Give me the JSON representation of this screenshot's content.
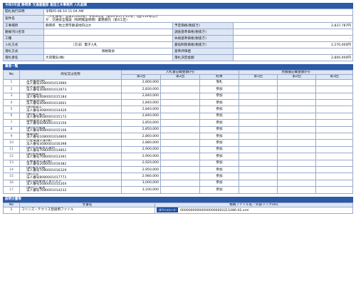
{
  "title": "令和5年度 静岡県 交通基盤部 島田土木事務所 入札結果",
  "info": {
    "rows": [
      {
        "label": "開札執行日時",
        "value": "令和05-06-10 11:04 AM"
      },
      {
        "label": "案件名",
        "value_line1": "（入札番号）島第21000号）令和3年度［第33-D571-01号］(国)150号ほか",
        "value_line2": "か　交通安全施設（照明施設修繕）業務委託（第4工区）"
      },
      {
        "label": "工事場所",
        "value": "静岡県　牧之原市静波地内ほか",
        "right_label": "予定価格(税抜き)",
        "right_value": "2,837,787円"
      },
      {
        "label": "路線河川名等",
        "value": "",
        "right_label": "調査基準価格(税抜き)",
        "right_value": ""
      },
      {
        "label": "工種",
        "value": "",
        "right_label": "失格基準価格(税抜き)",
        "right_value": "-"
      },
      {
        "label": "入札方式",
        "value": "（方法）電子入札",
        "right_label": "最低制限価格(税抜き)",
        "right_value": "2,270,000円"
      },
      {
        "label": "落札方式",
        "value": "価格競争",
        "right_label": "基準評価値",
        "right_value": "-"
      },
      {
        "label": "落札者名",
        "value": "大同電気(株)",
        "right_label": "落札決定金額",
        "right_value": "2,800,000円"
      }
    ]
  },
  "bidders_section": {
    "title": "業者一覧",
    "col_no": "No",
    "col_name": "商号又は名称",
    "group1": "入札書記載金額(円)",
    "group2": "見積書記載金額(円)",
    "round1": "第1回",
    "round2": "第2回",
    "round3": "第3回",
    "result": "結果"
  },
  "bidders": [
    {
      "no": "1",
      "name": "大同電気(株)",
      "corp": "法人番号2080001013990",
      "bid1": "2,800,000",
      "result": "落札"
    },
    {
      "no": "2",
      "name": "鈴木電気(株)",
      "corp": "法人番号3080001013973",
      "bid1": "2,830,000",
      "result": "参加"
    },
    {
      "no": "3",
      "name": "(株)田電舎",
      "corp": "法人番号4080001015184",
      "bid1": "2,840,000",
      "result": "参加"
    },
    {
      "no": "4",
      "name": "影嶋電気(株)",
      "corp": "法人番号4080001013601",
      "bid1": "2,840,000",
      "result": "参加"
    },
    {
      "no": "5",
      "name": "(株)橋電工",
      "corp": "法人番号4080001014426",
      "bid1": "2,840,000",
      "result": "参加"
    },
    {
      "no": "6",
      "name": "(株)富士電工",
      "corp": "法人番号8080001015172",
      "bid1": "2,840,000",
      "result": "参加"
    },
    {
      "no": "7",
      "name": "高橋電気工業(株)",
      "corp": "法人番号6080001013156",
      "bid1": "2,850,000",
      "result": "参加"
    },
    {
      "no": "8",
      "name": "(株)古月電設",
      "corp": "法人番号9080001015106",
      "bid1": "2,850,000",
      "result": "参加"
    },
    {
      "no": "9",
      "name": "構電(株)",
      "corp": "法人番号1080001014800",
      "bid1": "2,860,000",
      "result": "参加"
    },
    {
      "no": "10",
      "name": "小笠電設工業(株)",
      "corp": "法人番号3080001016398",
      "bid1": "2,880,000",
      "result": "参加"
    },
    {
      "no": "11",
      "name": "(株)三和電気工業所",
      "corp": "法人番号7080001014852",
      "bid1": "2,900,000",
      "result": "参加"
    },
    {
      "no": "12",
      "name": "(株)五和電機",
      "corp": "法人番号7080001013391",
      "bid1": "2,900,000",
      "result": "参加"
    },
    {
      "no": "13",
      "name": "太陽電気工業(株)",
      "corp": "法人番号2080001016382",
      "bid1": "2,920,000",
      "result": "参加"
    },
    {
      "no": "14",
      "name": "(株)電化奈緒",
      "corp": "法人番号7080001016329",
      "bid1": "2,950,000",
      "result": "参加"
    },
    {
      "no": "15",
      "name": "(株)大信",
      "corp": "法人番号8080001017771",
      "bid1": "2,980,000",
      "result": "参加"
    },
    {
      "no": "16",
      "name": "(株)羽根東海フォレスト",
      "corp": "法人番号5080001015204",
      "bid1": "3,000,000",
      "result": "参加"
    },
    {
      "no": "17",
      "name": "(株)川上電気",
      "corp": "法人番号7080001014232",
      "bid1": "3,100,000",
      "result": "参加"
    }
  ],
  "docs_section": {
    "title": "説明文書等",
    "col_no": "No",
    "col_doc": "文書名",
    "col_file": "格納ファイル名／外部リンクURL",
    "rows": [
      {
        "no": "1",
        "doc": "コリンズ・テクリス登録用ファイル",
        "button": "ダウンロード",
        "file": "000000000000000000002211086-02.xml"
      }
    ]
  }
}
